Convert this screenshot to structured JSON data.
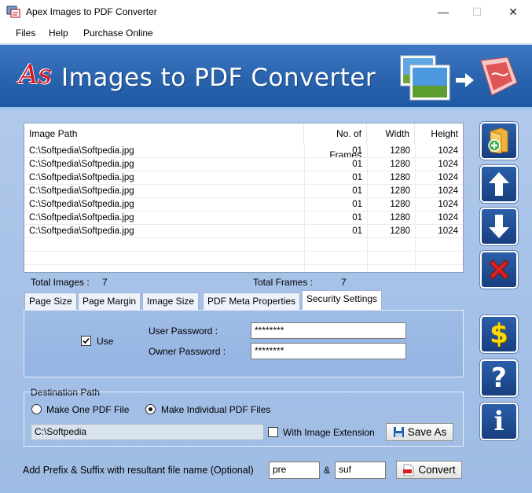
{
  "window": {
    "title": "Apex Images to PDF Converter",
    "minimize": "—",
    "maximize": "☐",
    "close": "✕"
  },
  "menu": [
    "Files",
    "Help",
    "Purchase Online"
  ],
  "banner": {
    "logo_text": "As",
    "title": "Images to PDF Converter"
  },
  "file_list": {
    "headers": [
      "Image Path",
      "No. of Frames",
      "Width",
      "Height"
    ],
    "rows": [
      [
        "C:\\Softpedia\\Softpedia.jpg",
        "01",
        "1280",
        "1024"
      ],
      [
        "C:\\Softpedia\\Softpedia.jpg",
        "01",
        "1280",
        "1024"
      ],
      [
        "C:\\Softpedia\\Softpedia.jpg",
        "01",
        "1280",
        "1024"
      ],
      [
        "C:\\Softpedia\\Softpedia.jpg",
        "01",
        "1280",
        "1024"
      ],
      [
        "C:\\Softpedia\\Softpedia.jpg",
        "01",
        "1280",
        "1024"
      ],
      [
        "C:\\Softpedia\\Softpedia.jpg",
        "01",
        "1280",
        "1024"
      ],
      [
        "C:\\Softpedia\\Softpedia.jpg",
        "01",
        "1280",
        "1024"
      ]
    ]
  },
  "totals": {
    "images_label": "Total Images :",
    "images_value": "7",
    "frames_label": "Total Frames :",
    "frames_value": "7"
  },
  "tabs": [
    "Page Size",
    "Page Margin",
    "Image Size",
    "PDF Meta Properties",
    "Security Settings"
  ],
  "active_tab": "Security Settings",
  "security": {
    "use_label": "Use",
    "use_checked": true,
    "user_password_label": "User Password :",
    "user_password_value": "********",
    "owner_password_label": "Owner Password :",
    "owner_password_value": "********"
  },
  "destination": {
    "group_label": "Destination Path",
    "option_one": "Make One PDF File",
    "option_individual": "Make Individual PDF Files",
    "selected": "Make Individual PDF Files",
    "path_value": "C:\\Softpedia",
    "with_extension_label": "With Image Extension",
    "with_extension_checked": false,
    "save_as_label": "Save As"
  },
  "prefix_suffix": {
    "label": "Add Prefix & Suffix with resultant file name (Optional)",
    "prefix_value": "pre",
    "ampersand": "&",
    "suffix_value": "suf",
    "convert_label": "Convert"
  },
  "side_buttons": [
    {
      "name": "add-files",
      "icon": "folder-add-icon"
    },
    {
      "name": "move-up",
      "icon": "arrow-up-icon"
    },
    {
      "name": "move-down",
      "icon": "arrow-down-icon"
    },
    {
      "name": "remove",
      "icon": "delete-x-icon"
    },
    {
      "name": "purchase",
      "icon": "dollar-icon"
    },
    {
      "name": "help",
      "icon": "question-icon"
    },
    {
      "name": "about",
      "icon": "info-icon"
    }
  ],
  "colors": {
    "banner_blue": "#2a63ad",
    "body_blue": "#a8c2e8",
    "side_button_blue": "#1f4c93",
    "delete_red": "#d32222",
    "dollar_yellow": "#ffd800"
  }
}
